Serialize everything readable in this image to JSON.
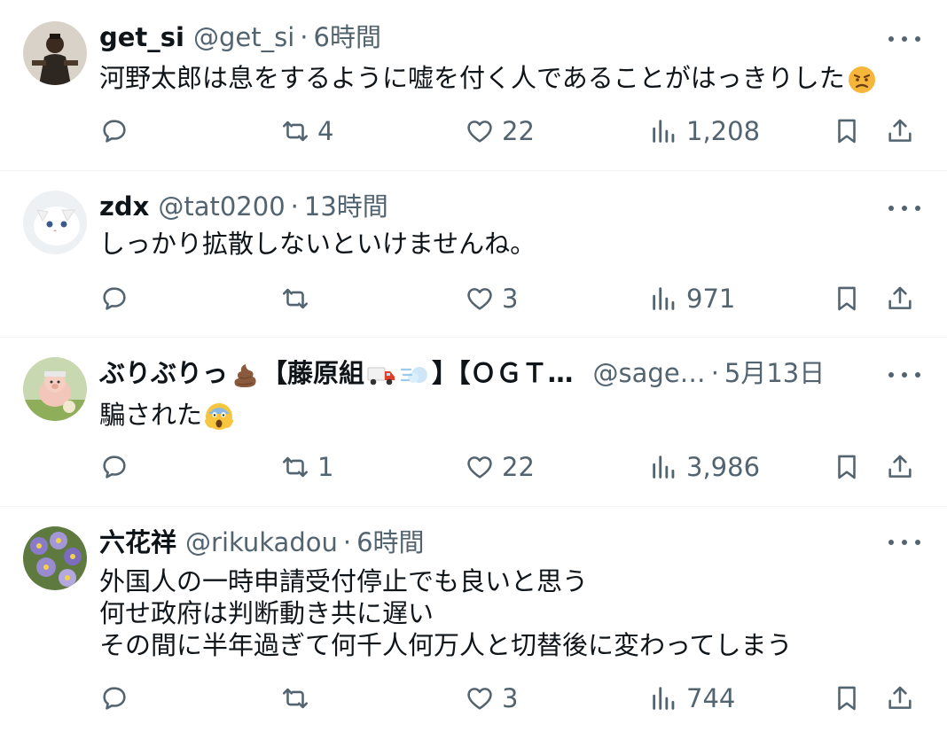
{
  "colors": {
    "text": "#0f1419",
    "secondary": "#536471",
    "divider": "#eff3f4"
  },
  "tweets": [
    {
      "name": "get_si",
      "handle": "@get_si",
      "sep": "·",
      "time": "6時間",
      "lines": [
        "河野太郎は息をするように嘘を付く人であることがはっきりした"
      ],
      "trailing_emoji": "angry-face-emoji",
      "reply_count": "",
      "retweet_count": "4",
      "like_count": "22",
      "view_count": "1,208"
    },
    {
      "name": "zdx",
      "handle": "@tat0200",
      "sep": "·",
      "time": "13時間",
      "lines": [
        "しっかり拡散しないといけませんね。"
      ],
      "reply_count": "",
      "retweet_count": "",
      "like_count": "3",
      "view_count": "971"
    },
    {
      "name_parts": [
        "ぶりぶりっ",
        "【藤原組",
        "】【ＯＧＴ…"
      ],
      "name_emojis": [
        "poop-emoji",
        "truck-emoji",
        "dash-emoji"
      ],
      "handle": "@sage…",
      "sep": "·",
      "time": "5月13日",
      "lines": [
        "騙された"
      ],
      "trailing_emoji": "scream-face-emoji",
      "reply_count": "",
      "retweet_count": "1",
      "like_count": "22",
      "view_count": "3,986"
    },
    {
      "name": "六花祥",
      "handle": "@rikukadou",
      "sep": "·",
      "time": "6時間",
      "lines": [
        "外国人の一時申請受付停止でも良いと思う",
        "何せ政府は判断動き共に遅い",
        "その間に半年過ぎて何千人何万人と切替後に変わってしまう"
      ],
      "reply_count": "",
      "retweet_count": "",
      "like_count": "3",
      "view_count": "744"
    }
  ]
}
